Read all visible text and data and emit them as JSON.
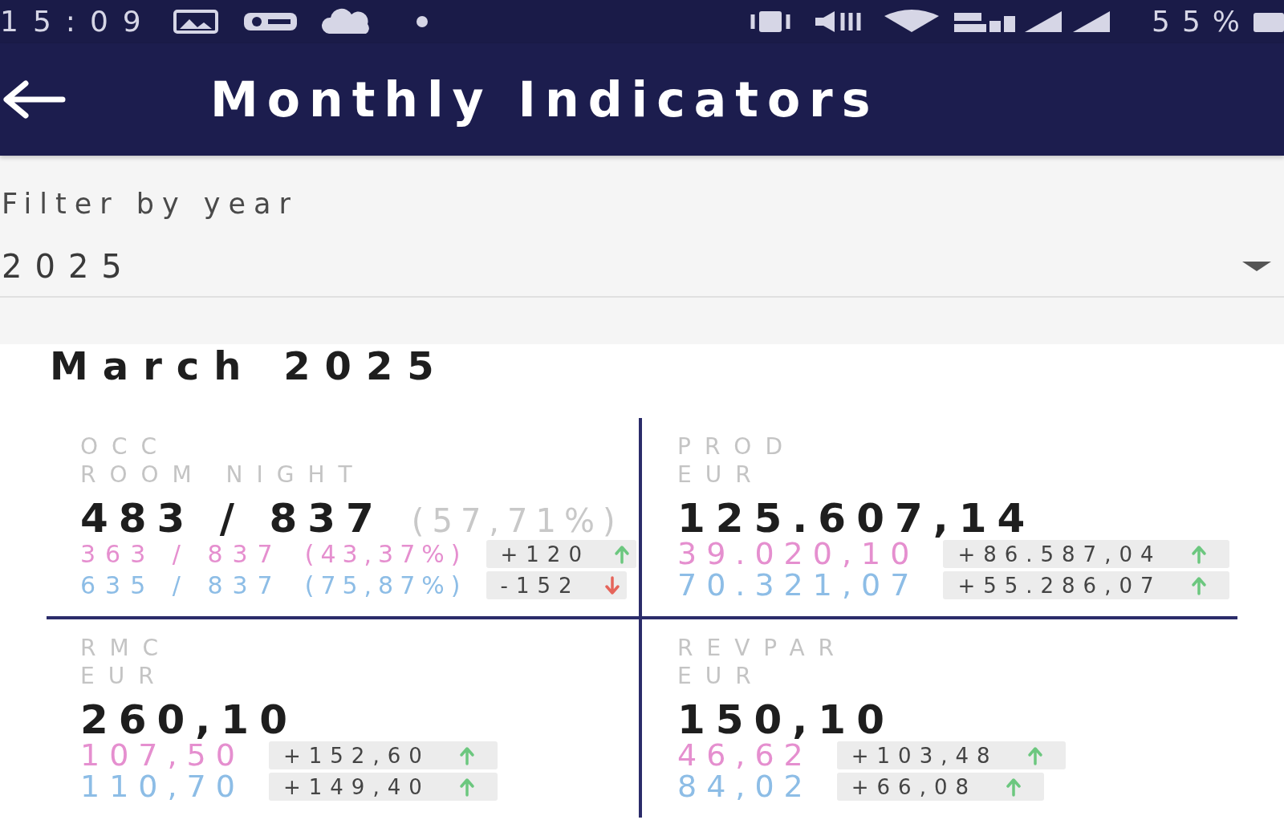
{
  "status_bar": {
    "time": "15:09",
    "battery": "55%"
  },
  "app_bar": {
    "title": "Monthly Indicators"
  },
  "filter": {
    "label": "Filter by year",
    "value": "2025"
  },
  "period": {
    "title": "March 2025"
  },
  "indicators": [
    {
      "label": "OCC",
      "unit": "ROOM NIGHT",
      "value": "483 / 837",
      "share": "(57,71%)",
      "comparisons": [
        {
          "value": "363 / 837",
          "share": "(43,37%)",
          "color": "#e58fcf",
          "delta": "+120",
          "rising": true
        },
        {
          "value": "635 / 837",
          "share": "(75,87%)",
          "color": "#8dbde6",
          "delta": "-152",
          "rising": false
        }
      ]
    },
    {
      "label": "PROD",
      "unit": "EUR",
      "value": "125.607,14",
      "comparisons": [
        {
          "value": "39.020,10",
          "color": "#e58fcf",
          "delta": "+86.587,04",
          "rising": true
        },
        {
          "value": "70.321,07",
          "color": "#8dbde6",
          "delta": "+55.286,07",
          "rising": true
        }
      ]
    },
    {
      "label": "RMC",
      "unit": "EUR",
      "value": "260,10",
      "comparisons": [
        {
          "value": "107,50",
          "color": "#e58fcf",
          "delta": "+152,60",
          "rising": true
        },
        {
          "value": "110,70",
          "color": "#8dbde6",
          "delta": "+149,40",
          "rising": true
        }
      ]
    },
    {
      "label": "REVPAR",
      "unit": "EUR",
      "value": "150,10",
      "comparisons": [
        {
          "value": "46,62",
          "color": "#e58fcf",
          "delta": "+103,48",
          "rising": true
        },
        {
          "value": "84,02",
          "color": "#8dbde6",
          "delta": "+66,08",
          "rising": true
        }
      ]
    }
  ]
}
